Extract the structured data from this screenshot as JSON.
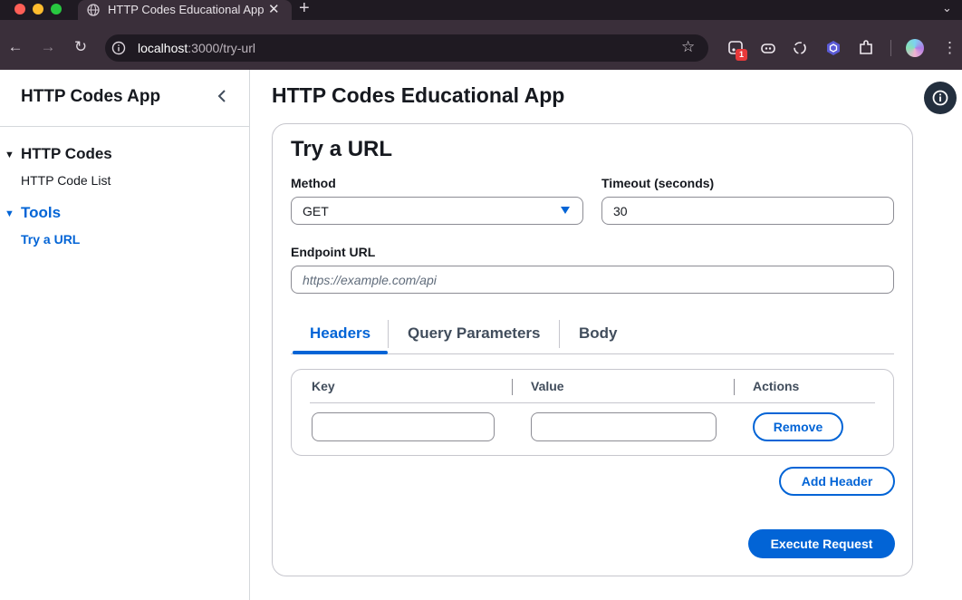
{
  "browser": {
    "tab_title": "HTTP Codes Educational App",
    "new_tab_label": "+",
    "url_host": "localhost",
    "url_path": ":3000/try-url",
    "extension_badge": "1"
  },
  "sidebar": {
    "title": "HTTP Codes App",
    "sections": [
      {
        "label": "HTTP Codes",
        "items": [
          {
            "label": "HTTP Code List"
          }
        ]
      },
      {
        "label": "Tools",
        "items": [
          {
            "label": "Try a URL"
          }
        ]
      }
    ]
  },
  "main": {
    "title": "HTTP Codes Educational App",
    "form": {
      "title": "Try a URL",
      "method_label": "Method",
      "method_value": "GET",
      "timeout_label": "Timeout (seconds)",
      "timeout_value": "30",
      "endpoint_label": "Endpoint URL",
      "endpoint_placeholder": "https://example.com/api",
      "endpoint_value": ""
    },
    "tabs": [
      {
        "label": "Headers"
      },
      {
        "label": "Query Parameters"
      },
      {
        "label": "Body"
      }
    ],
    "active_tab": "Headers",
    "headers_table": {
      "columns": [
        "Key",
        "Value",
        "Actions"
      ],
      "rows": [
        {
          "key": "",
          "value": "",
          "action_label": "Remove"
        }
      ]
    },
    "add_header_label": "Add Header",
    "execute_label": "Execute Request"
  },
  "colors": {
    "accent": "#0264d6",
    "text": "#16191f",
    "border": "#c6c6cd",
    "browser_tabbar": "#1f1a22",
    "browser_toolbar": "#3a2f3a",
    "info_button": "#232f3e"
  }
}
